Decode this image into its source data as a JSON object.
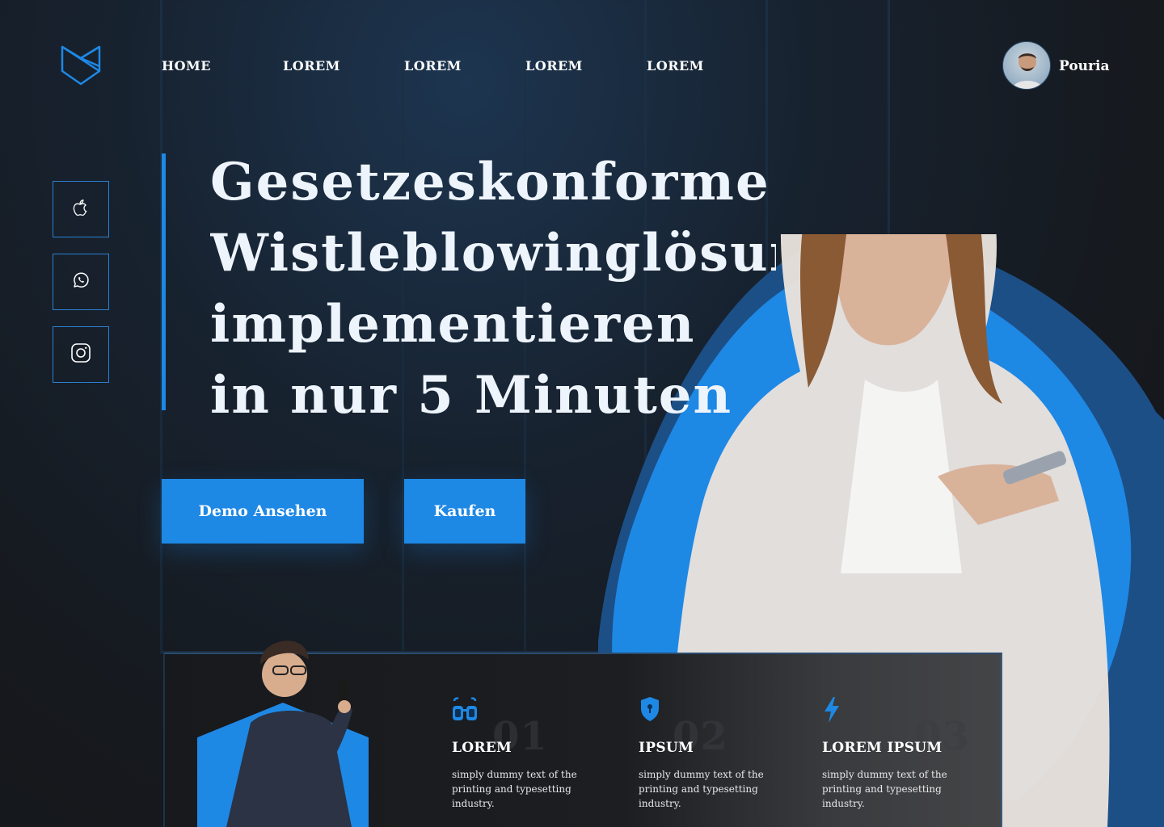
{
  "brand": {
    "logo_icon": "shield-logo-icon",
    "accent_color": "#1e88e5"
  },
  "nav": {
    "items": [
      "HOME",
      "LOREM",
      "LOREM",
      "LOREM",
      "LOREM"
    ]
  },
  "user": {
    "name": "Pouria",
    "avatar_icon": "user-avatar"
  },
  "social": [
    {
      "icon": "apple-icon"
    },
    {
      "icon": "whatsapp-icon"
    },
    {
      "icon": "instagram-icon"
    }
  ],
  "hero": {
    "title_lines": [
      "Gesetzeskonforme",
      "Wistleblowinglösung",
      "implementieren",
      "in nur 5 Minuten"
    ],
    "primary_button": "Demo Ansehen",
    "secondary_button": "Kaufen"
  },
  "features": [
    {
      "icon": "glasses-icon",
      "number": "01",
      "title": "LOREM",
      "description": "simply dummy text of the printing and typesetting industry."
    },
    {
      "icon": "shield-icon",
      "number": "02",
      "title": "IPSUM",
      "description": "simply dummy text of the printing and typesetting industry."
    },
    {
      "icon": "lightning-icon",
      "number": "03",
      "title": "LOREM IPSUM",
      "description": "simply dummy text of the printing and typesetting industry."
    }
  ]
}
